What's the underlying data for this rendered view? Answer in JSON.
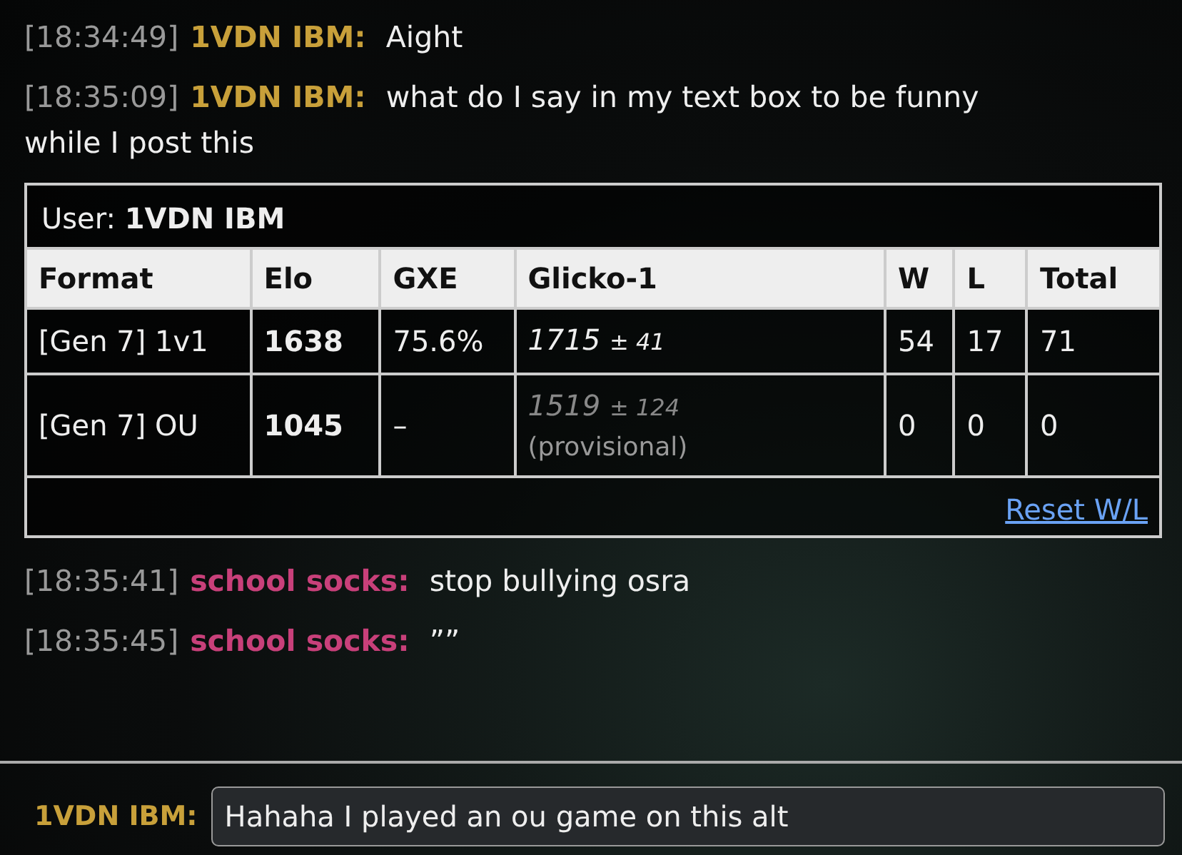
{
  "messages_before": [
    {
      "time": "[18:34:49]",
      "user": "1VDN IBM:",
      "color": "#c8a03a",
      "text": "Aight"
    },
    {
      "time": "[18:35:09]",
      "user": "1VDN IBM:",
      "color": "#c8a03a",
      "text": "what do I say in my text box to be funny",
      "wrap": "while I post this"
    }
  ],
  "ladder": {
    "user_label": "User:",
    "user": "1VDN IBM",
    "columns": [
      "Format",
      "Elo",
      "GXE",
      "Glicko-1",
      "W",
      "L",
      "Total"
    ],
    "rows": [
      {
        "format": "[Gen 7] 1v1",
        "elo": "1638",
        "gxe": "75.6%",
        "rating": "1715",
        "deviation": "± 41",
        "provisional": false,
        "w": "54",
        "l": "17",
        "total": "71"
      },
      {
        "format": "[Gen 7] OU",
        "elo": "1045",
        "gxe": "–",
        "rating": "1519",
        "deviation": "± 124",
        "provisional": true,
        "note": "(provisional)",
        "w": "0",
        "l": "0",
        "total": "0"
      }
    ],
    "reset_link": "Reset W/L"
  },
  "messages_after": [
    {
      "time": "[18:35:41]",
      "user": "school socks:",
      "color": "#c8407a",
      "text": "stop bullying osra"
    },
    {
      "time": "[18:35:45]",
      "user": "school socks:",
      "color": "#c8407a",
      "text": "””"
    }
  ],
  "compose": {
    "user": "1VDN IBM:",
    "value": "Hahaha I played an ou game on this alt"
  }
}
